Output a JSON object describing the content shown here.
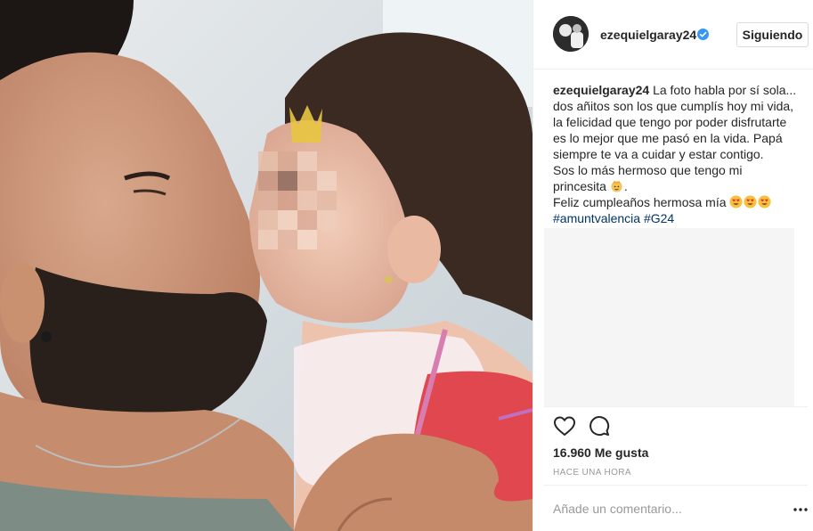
{
  "post": {
    "username": "ezequielgaray24",
    "verified": true,
    "follow_label": "Siguiendo",
    "caption_user": "ezequielgaray24",
    "caption_lines": [
      "La foto habla por sí sola...",
      "dos añitos son los que cumplís hoy mi vida,",
      "la felicidad que tengo por poder disfrutarte",
      "es lo mejor que me pasó en la vida. Papá",
      "siempre te va a cuidar y estar contigo.",
      "Sos lo más hermoso que tengo mi",
      "princesita",
      "Feliz cumpleaños hermosa mía"
    ],
    "hashtags": [
      "#amuntvalencia",
      "#G24"
    ],
    "likes": "16.960 Me gusta",
    "timestamp": "HACE UNA HORA",
    "comment_placeholder": "Añade un comentario...",
    "icons": {
      "verified": "verified-badge-icon",
      "like": "heart-icon",
      "comment": "comment-icon",
      "more": "more-options-icon",
      "princess_emoji": "princess-emoji-icon",
      "heart_eyes_emoji": "heart-eyes-emoji-icon"
    },
    "colors": {
      "verified_blue": "#3897f0",
      "hashtag": "#003569",
      "secondary_text": "#999999"
    }
  }
}
